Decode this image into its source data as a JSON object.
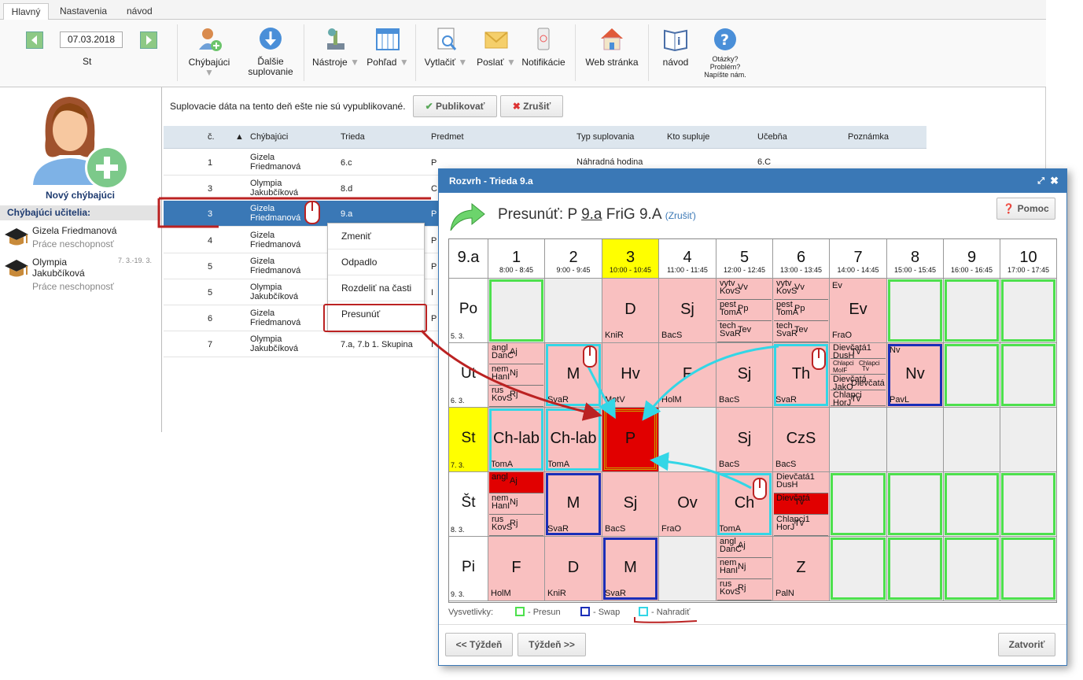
{
  "tabs": [
    "Hlavný",
    "Nastavenia",
    "návod"
  ],
  "date": "07.03.2018",
  "weekday": "St",
  "toolbar": {
    "chybajuci": "Chýbajúci",
    "dalsie1": "Ďalšie",
    "dalsie2": "suplovanie",
    "nastroje": "Nástroje",
    "pohlad": "Pohľad",
    "vytlacit": "Vytlačiť",
    "poslat": "Poslať",
    "notifikacie": "Notifikácie",
    "web": "Web stránka",
    "navod": "návod",
    "q1": "Otázky?",
    "q2": "Problém?",
    "q3": "Napíšte nám."
  },
  "left": {
    "new_absent": "Nový chýbajúci",
    "header": "Chýbajúci učitelia:",
    "t1_name": "Gizela Friedmanová",
    "t1_reason": "Práce neschopnosť",
    "t2_name1": "Olympia",
    "t2_name2": "Jakubčíková",
    "t2_dates": "7. 3.-19. 3.",
    "t2_reason": "Práce neschopnosť"
  },
  "main": {
    "notice": "Suplovacie dáta na tento deň ešte nie sú vypublikované.",
    "publish": "Publikovať",
    "cancel": "Zrušiť"
  },
  "table": {
    "headers": [
      "č.",
      "▲",
      "Chýbajúci",
      "Trieda",
      "Predmet",
      "Typ suplovania",
      "Kto supluje",
      "Učebňa",
      "Poznámka"
    ],
    "rows": [
      [
        "1",
        "Gizela",
        "Friedmanová",
        "6.c",
        "P",
        "Náhradná hodina",
        "6.C"
      ],
      [
        "3",
        "Olympia",
        "Jakubčíková",
        "8.d",
        "C",
        "",
        ""
      ],
      [
        "3",
        "Gizela",
        "Friedmanová",
        "9.a",
        "P",
        "",
        ""
      ],
      [
        "4",
        "Gizela",
        "Friedmanová",
        "",
        "P",
        "",
        ""
      ],
      [
        "5",
        "Gizela",
        "Friedmanová",
        "",
        "P",
        "",
        ""
      ],
      [
        "5",
        "Olympia",
        "Jakubčíková",
        "",
        "I",
        "",
        ""
      ],
      [
        "6",
        "Gizela",
        "Friedmanová",
        "",
        "P",
        "",
        ""
      ],
      [
        "7",
        "Olympia",
        "Jakubčíková",
        "7.a, 7.b 1. Skupina",
        "I",
        "",
        ""
      ]
    ]
  },
  "context": [
    "Zmeniť",
    "Odpadlo",
    "Rozdeliť na časti",
    "Presunúť"
  ],
  "dialog": {
    "title": "Rozvrh - Trieda 9.a",
    "move_prefix": "Presunúť: P",
    "move_class": "9.a",
    "move_suffix": "FriG 9.A",
    "move_cancel": "(Zrušiť)",
    "help": "Pomoc",
    "corner": "9.a",
    "periods": [
      [
        "1",
        "8:00 - 8:45"
      ],
      [
        "2",
        "9:00 - 9:45"
      ],
      [
        "3",
        "10:00 - 10:45"
      ],
      [
        "4",
        "11:00 - 11:45"
      ],
      [
        "5",
        "12:00 - 12:45"
      ],
      [
        "6",
        "13:00 - 13:45"
      ],
      [
        "7",
        "14:00 - 14:45"
      ],
      [
        "8",
        "15:00 - 15:45"
      ],
      [
        "9",
        "16:00 - 16:45"
      ],
      [
        "10",
        "17:00 - 17:45"
      ]
    ],
    "days": [
      [
        "Po",
        "5. 3."
      ],
      [
        "Ut",
        "6. 3."
      ],
      [
        "St",
        "7. 3."
      ],
      [
        "Št",
        "8. 3."
      ],
      [
        "Pi",
        "9. 3."
      ]
    ],
    "legend_label": "Vysvetlivky:",
    "legend_presun": "- Presun",
    "legend_swap": "- Swap",
    "legend_nahradit": "- Nahradiť",
    "prev_week": "<< Týždeň",
    "next_week": "Týždeň >>",
    "close": "Zatvoriť"
  },
  "lessons": {
    "po2": {
      "big": "",
      "s": ""
    },
    "po3": {
      "big": "D",
      "s": "KniR"
    },
    "po4": {
      "big": "Sj",
      "s": "BacS"
    },
    "po5": [
      [
        "vytv",
        "Vv",
        "KovS"
      ],
      [
        "pest",
        "Pp",
        "TomA"
      ],
      [
        "tech",
        "Tev",
        "SvaR"
      ]
    ],
    "po6": [
      [
        "vytv",
        "Vv",
        "KovS"
      ],
      [
        "pest",
        "Pp",
        "TomA"
      ],
      [
        "tech",
        "Tev",
        "SvaR"
      ]
    ],
    "po7": {
      "big": "Ev",
      "top": "Ev",
      "s": "FraO"
    },
    "ut1": [
      [
        "angl",
        "Aj",
        "DanC"
      ],
      [
        "nem",
        "Nj",
        "HanI"
      ],
      [
        "rus",
        "Rj",
        "KovS"
      ]
    ],
    "ut2": {
      "big": "M",
      "s": "SvaR"
    },
    "ut3": {
      "big": "Hv",
      "s": "MotV"
    },
    "ut4": {
      "big": "F",
      "s": "HolM"
    },
    "ut5": {
      "big": "Sj",
      "s": "BacS"
    },
    "ut6": {
      "big": "Th",
      "s": "SvaR"
    },
    "ut7": [
      [
        "Dievčatá1",
        "Tv",
        "DusH"
      ],
      [
        "Chlapci",
        "Chlapci",
        "MoIF",
        "Tv"
      ],
      [
        "Dievčatá",
        "Dievčatá",
        "JakO"
      ],
      [
        "Chlapci",
        "Tv",
        "HorJ"
      ]
    ],
    "ut8": {
      "big": "Nv",
      "top": "Nv",
      "s": "PavL"
    },
    "st1": {
      "big": "Ch-lab",
      "s": "TomA"
    },
    "st2": {
      "big": "Ch-lab",
      "s": "TomA"
    },
    "st3": {
      "big": "P",
      "s": ""
    },
    "st5": {
      "big": "Sj",
      "s": "BacS"
    },
    "st6": {
      "big": "CzS",
      "s": "BacS"
    },
    "st_1": [
      [
        "angl",
        "Aj",
        ""
      ],
      [
        "nem",
        "Nj",
        "HanI"
      ],
      [
        "rus",
        "Rj",
        "KovS"
      ]
    ],
    "st_2": {
      "big": "M",
      "s": "SvaR"
    },
    "st_3": {
      "big": "Sj",
      "s": "BacS"
    },
    "st_4": {
      "big": "Ov",
      "s": "FraO"
    },
    "st_5": {
      "big": "Ch",
      "s": "TomA"
    },
    "st_6": [
      [
        "Dievčatá1",
        "",
        "DusH"
      ],
      [
        "Dievčatá",
        "Tv",
        ""
      ],
      [
        "Chlapci1",
        "Tv",
        "HorJ"
      ]
    ],
    "pi1": {
      "big": "F",
      "s": "HolM"
    },
    "pi2": {
      "big": "D",
      "s": "KniR"
    },
    "pi3": {
      "big": "M",
      "s": "SvaR"
    },
    "pi5": [
      [
        "angl",
        "Aj",
        "DanC"
      ],
      [
        "nem",
        "Nj",
        "HanI"
      ],
      [
        "rus",
        "Rj",
        "KovS"
      ]
    ],
    "pi6": {
      "big": "Z",
      "s": "PalN"
    }
  },
  "colors": {
    "accent": "#3a78b6",
    "lesson": "#f9c0c0",
    "selected": "#e10000",
    "highlight": "#ffff00",
    "presun": "#4de04d",
    "swap": "#1a2eb8",
    "nahradit": "#33d6e6"
  }
}
